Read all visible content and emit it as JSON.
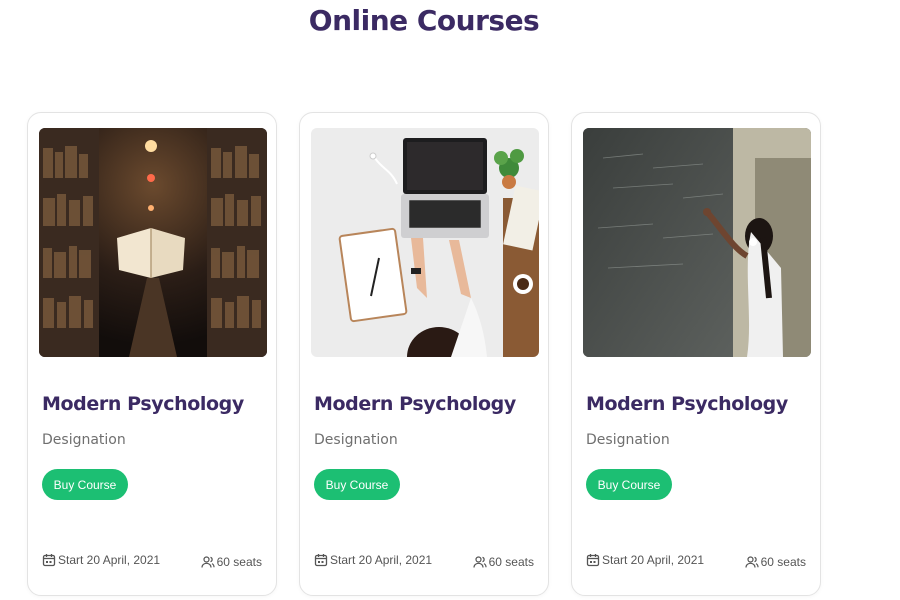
{
  "page": {
    "title": "Online Courses"
  },
  "courses": [
    {
      "image": "library-books-photo",
      "title": "Modern Psychology",
      "designation": "Designation",
      "buy_label": "Buy Course",
      "start": "Start 20 April, 2021",
      "seats": "60 seats"
    },
    {
      "image": "laptop-desk-photo",
      "title": "Modern Psychology",
      "designation": "Designation",
      "buy_label": "Buy Course",
      "start": "Start 20 April, 2021",
      "seats": "60 seats"
    },
    {
      "image": "chalkboard-student-photo",
      "title": "Modern Psychology",
      "designation": "Designation",
      "buy_label": "Buy Course",
      "start": "Start 20 April, 2021",
      "seats": "60 seats"
    }
  ],
  "colors": {
    "title": "#3b2a63",
    "button": "#1cbf73",
    "card_border": "#e3e3e3"
  },
  "icons": {
    "calendar": "calendar-icon",
    "seats": "users-icon"
  }
}
